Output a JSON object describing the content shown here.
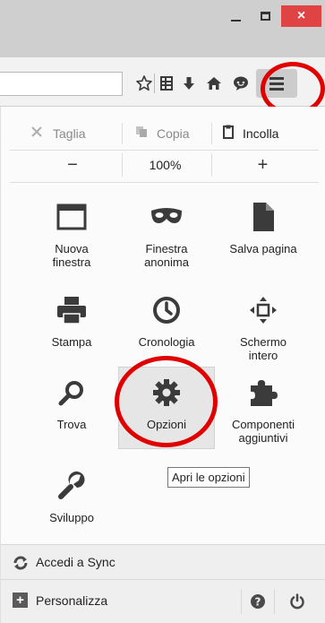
{
  "window": {
    "close_glyph": "×"
  },
  "toolbar": {
    "icons": [
      "bookmark-star-icon",
      "reading-list-icon",
      "download-icon",
      "home-icon",
      "chat-icon",
      "menu-icon"
    ]
  },
  "menu": {
    "edit": {
      "cut": "Taglia",
      "copy": "Copia",
      "paste": "Incolla"
    },
    "zoom": {
      "out": "−",
      "level": "100%",
      "in": "+"
    },
    "tiles": {
      "new_window": [
        "Nuova",
        "finestra"
      ],
      "private_window": [
        "Finestra",
        "anonima"
      ],
      "save_page": [
        "Salva pagina"
      ],
      "print": [
        "Stampa"
      ],
      "history": [
        "Cronologia"
      ],
      "fullscreen": [
        "Schermo",
        "intero"
      ],
      "find": [
        "Trova"
      ],
      "options": [
        "Opzioni"
      ],
      "addons": [
        "Componenti",
        "aggiuntivi"
      ],
      "developer": [
        "Sviluppo"
      ]
    },
    "tooltip": "Apri le opzioni",
    "sync": "Accedi a Sync",
    "customize": "Personalizza",
    "customize_glyph": "+"
  },
  "colors": {
    "highlight_ring": "#e00000",
    "close_button": "#e04343",
    "icon": "#3b3b3b"
  }
}
